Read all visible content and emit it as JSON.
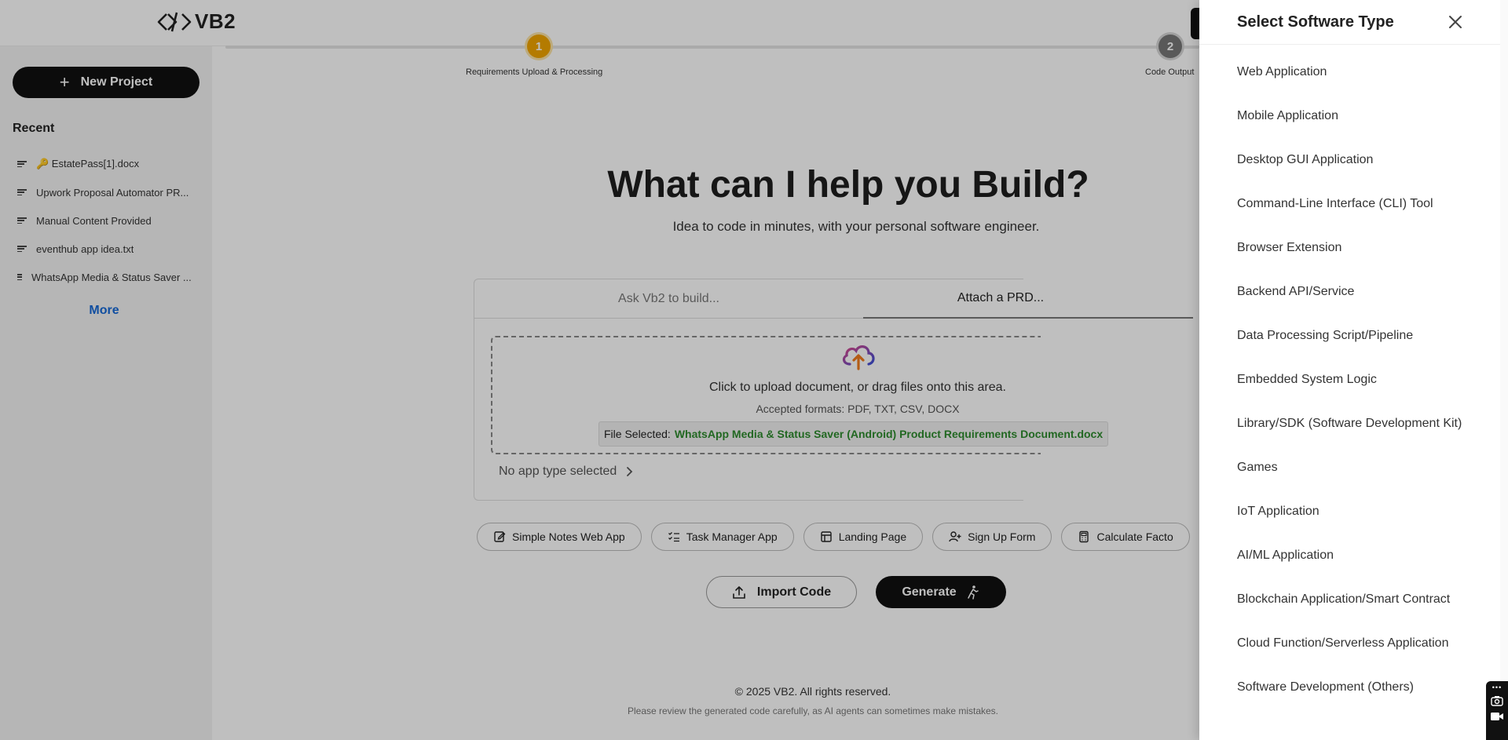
{
  "app": {
    "logo_text": "VB2"
  },
  "sidebar": {
    "new_project_label": "New Project",
    "recent_title": "Recent",
    "recent_items": [
      {
        "label": "🔑 EstatePass[1].docx"
      },
      {
        "label": "Upwork Proposal Automator PR..."
      },
      {
        "label": "Manual Content Provided"
      },
      {
        "label": "eventhub app idea.txt"
      },
      {
        "label": "WhatsApp Media & Status Saver ..."
      }
    ],
    "more_label": "More"
  },
  "stepper": {
    "steps": [
      {
        "number": "1",
        "label": "Requirements Upload & Processing"
      },
      {
        "number": "2",
        "label": "Code Output"
      }
    ]
  },
  "hero": {
    "title": "What can I help you Build?",
    "subtitle": "Idea to code in minutes, with your personal software engineer."
  },
  "composer": {
    "tab_ask": "Ask Vb2 to build...",
    "tab_attach": "Attach a PRD...",
    "drop_text": "Click to upload document, or drag files onto this area.",
    "formats": "Accepted formats: PDF, TXT, CSV, DOCX",
    "file_selected_label": "File Selected:",
    "file_name": "WhatsApp Media & Status Saver (Android) Product Requirements Document.docx",
    "app_type_label": "No app type selected"
  },
  "chips": [
    {
      "label": "Simple Notes Web App",
      "icon": "edit-note-icon"
    },
    {
      "label": "Task Manager App",
      "icon": "checklist-icon"
    },
    {
      "label": "Landing Page",
      "icon": "layout-icon"
    },
    {
      "label": "Sign Up Form",
      "icon": "user-plus-icon"
    },
    {
      "label": "Calculate Facto",
      "icon": "calculator-icon"
    }
  ],
  "actions": {
    "import_label": "Import Code",
    "generate_label": "Generate"
  },
  "footer": {
    "copyright": "© 2025 VB2. All rights reserved.",
    "note": "Please review the generated code carefully, as AI agents can sometimes make mistakes."
  },
  "drawer": {
    "title": "Select Software Type",
    "types": [
      "Web Application",
      "Mobile Application",
      "Desktop GUI Application",
      "Command-Line Interface (CLI) Tool",
      "Browser Extension",
      "Backend API/Service",
      "Data Processing Script/Pipeline",
      "Embedded System Logic",
      "Library/SDK (Software Development Kit)",
      "Games",
      "IoT Application",
      "AI/ML Application",
      "Blockchain Application/Smart Contract",
      "Cloud Function/Serverless Application",
      "Software Development (Others)"
    ]
  },
  "colors": {
    "accent_step": "#f0a500",
    "file_name": "#2e8b2e",
    "link": "#1669d6",
    "primary_button": "#111111"
  }
}
